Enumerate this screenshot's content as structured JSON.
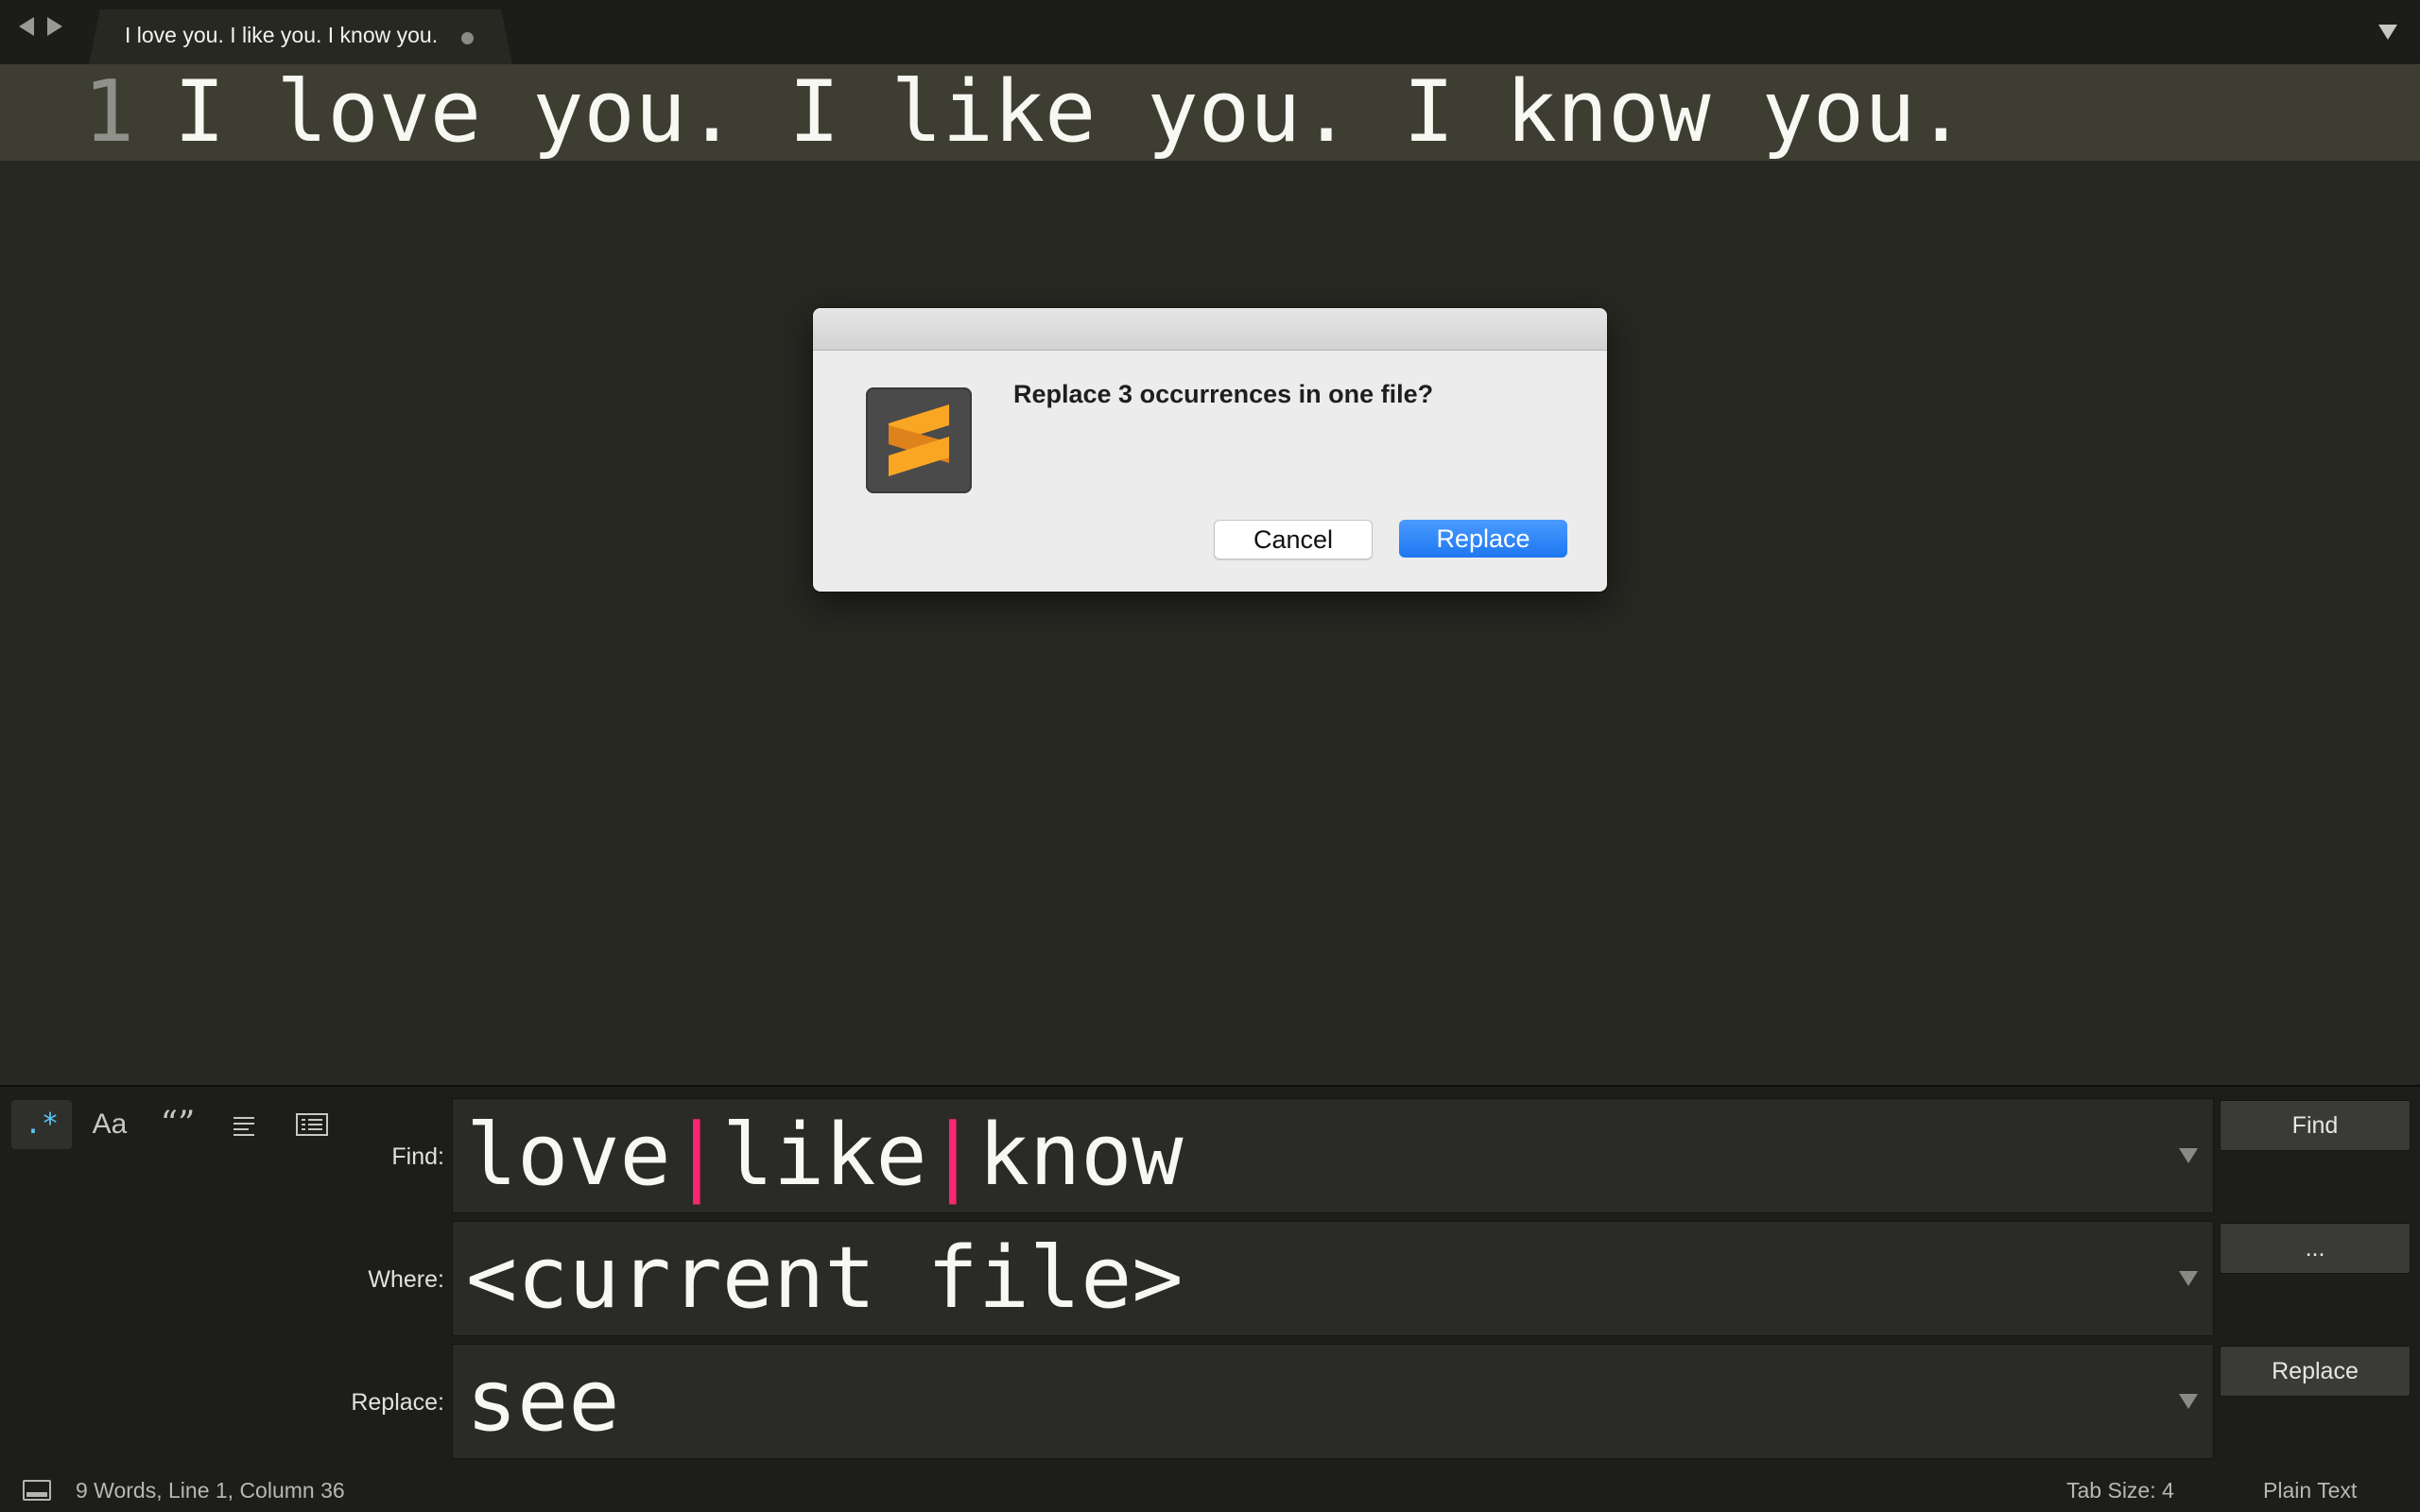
{
  "tabbar": {
    "tab_title": "I love you. I like you. I know you."
  },
  "editor": {
    "line_number": "1",
    "line_text": "I love you. I like you. I know you."
  },
  "dialog": {
    "message": "Replace 3 occurrences in one file?",
    "cancel_label": "Cancel",
    "replace_label": "Replace"
  },
  "find_panel": {
    "options": {
      "regex_label": ".*",
      "case_label": "Aa",
      "word_label": "“”"
    },
    "find_label": "Find:",
    "find_parts": [
      "love",
      "|",
      "like",
      "|",
      "know"
    ],
    "where_label": "Where:",
    "where_value": "<current file>",
    "replace_label": "Replace:",
    "replace_value": "see",
    "find_button": "Find",
    "where_button": "...",
    "replace_button": "Replace"
  },
  "statusbar": {
    "info": "9 Words, Line 1, Column 36",
    "tab_size": "Tab Size: 4",
    "syntax": "Plain Text"
  },
  "colors": {
    "accent_blue": "#1e77f1",
    "regex_pipe": "#f92672",
    "sublime_orange": "#f5a623"
  }
}
